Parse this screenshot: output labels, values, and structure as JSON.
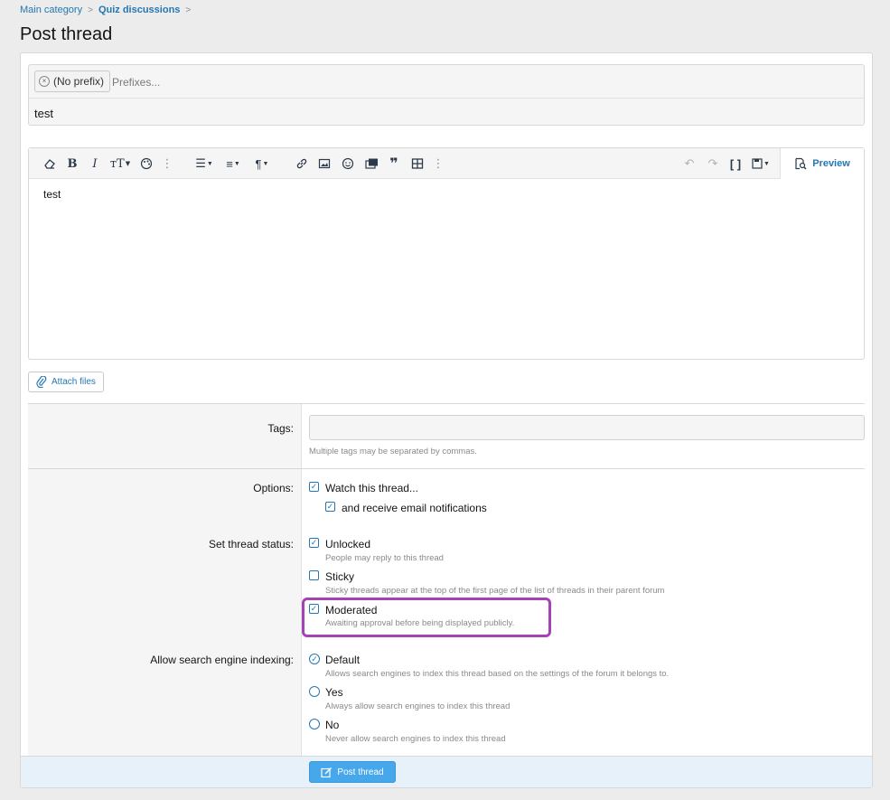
{
  "breadcrumb": {
    "item1": "Main category",
    "item2": "Quiz discussions",
    "sep": ">"
  },
  "page": {
    "title": "Post thread"
  },
  "thread_title": {
    "prefix_chip": "(No prefix)",
    "prefix_placeholder": "Prefixes...",
    "value": "test"
  },
  "editor": {
    "toolbar_icons": [
      "eraser-icon",
      "bold-icon",
      "italic-icon",
      "text-size-icon",
      "palette-icon",
      "more-icon",
      "list-icon",
      "align-icon",
      "paragraph-icon",
      "link-icon",
      "image-icon",
      "smile-icon",
      "media-icon",
      "quote-icon",
      "table-icon",
      "more-icon",
      "undo-icon",
      "redo-icon",
      "brackets-icon",
      "save-draft-icon"
    ],
    "preview_label": "Preview",
    "body": "test"
  },
  "attach": {
    "label": "Attach files"
  },
  "tags": {
    "label": "Tags:",
    "hint": "Multiple tags may be separated by commas.",
    "value": ""
  },
  "options": {
    "label": "Options:",
    "watch": {
      "label": "Watch this thread...",
      "checked": true
    },
    "email": {
      "label": "and receive email notifications",
      "checked": true
    }
  },
  "status": {
    "label": "Set thread status:",
    "unlocked": {
      "label": "Unlocked",
      "hint": "People may reply to this thread",
      "checked": true
    },
    "sticky": {
      "label": "Sticky",
      "hint": "Sticky threads appear at the top of the first page of the list of threads in their parent forum",
      "checked": false
    },
    "moderated": {
      "label": "Moderated",
      "hint": "Awaiting approval before being displayed publicly.",
      "checked": true
    }
  },
  "indexing": {
    "label": "Allow search engine indexing:",
    "default": {
      "label": "Default",
      "hint": "Allows search engines to index this thread based on the settings of the forum it belongs to.",
      "selected": true
    },
    "yes": {
      "label": "Yes",
      "hint": "Always allow search engines to index this thread",
      "selected": false
    },
    "no": {
      "label": "No",
      "hint": "Never allow search engines to index this thread",
      "selected": false
    }
  },
  "submit": {
    "label": "Post thread"
  },
  "colors": {
    "accent": "#2577b1",
    "button": "#47a7eb",
    "highlight": "#a542b8"
  }
}
